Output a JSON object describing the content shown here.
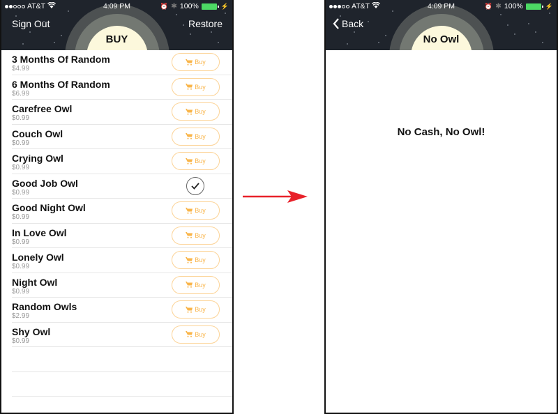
{
  "left_screen": {
    "status_bar": {
      "signal_bars_filled": 2,
      "signal_bars_total": 5,
      "carrier": "AT&T",
      "time": "4:09 PM",
      "battery": "100%"
    },
    "header": {
      "title": "BUY",
      "left_button": "Sign Out",
      "right_button": "Restore"
    },
    "products": [
      {
        "name": "3 Months Of Random",
        "price": "$4.99",
        "owned": false
      },
      {
        "name": "6 Months Of Random",
        "price": "$6.99",
        "owned": false
      },
      {
        "name": "Carefree Owl",
        "price": "$0.99",
        "owned": false
      },
      {
        "name": "Couch Owl",
        "price": "$0.99",
        "owned": false
      },
      {
        "name": "Crying Owl",
        "price": "$0.99",
        "owned": false
      },
      {
        "name": "Good Job Owl",
        "price": "$0.99",
        "owned": true
      },
      {
        "name": "Good Night Owl",
        "price": "$0.99",
        "owned": false
      },
      {
        "name": "In Love Owl",
        "price": "$0.99",
        "owned": false
      },
      {
        "name": "Lonely Owl",
        "price": "$0.99",
        "owned": false
      },
      {
        "name": "Night Owl",
        "price": "$0.99",
        "owned": false
      },
      {
        "name": "Random Owls",
        "price": "$2.99",
        "owned": false
      },
      {
        "name": "Shy Owl",
        "price": "$0.99",
        "owned": false
      }
    ],
    "buy_label": "Buy",
    "icons": {
      "buy": "cart-icon",
      "owned": "checkmark-icon"
    }
  },
  "right_screen": {
    "status_bar": {
      "signal_bars_filled": 3,
      "signal_bars_total": 5,
      "carrier": "AT&T",
      "time": "4:09 PM",
      "battery": "100%"
    },
    "header": {
      "title": "No Owl",
      "left_button": "Back"
    },
    "message": "No Cash, No Owl!"
  },
  "colors": {
    "header_bg": "#1f242c",
    "buy_accent": "#f9b54a",
    "buy_border": "#fcd396",
    "arrow": "#e8212a",
    "moon": "#fcf8dc"
  }
}
